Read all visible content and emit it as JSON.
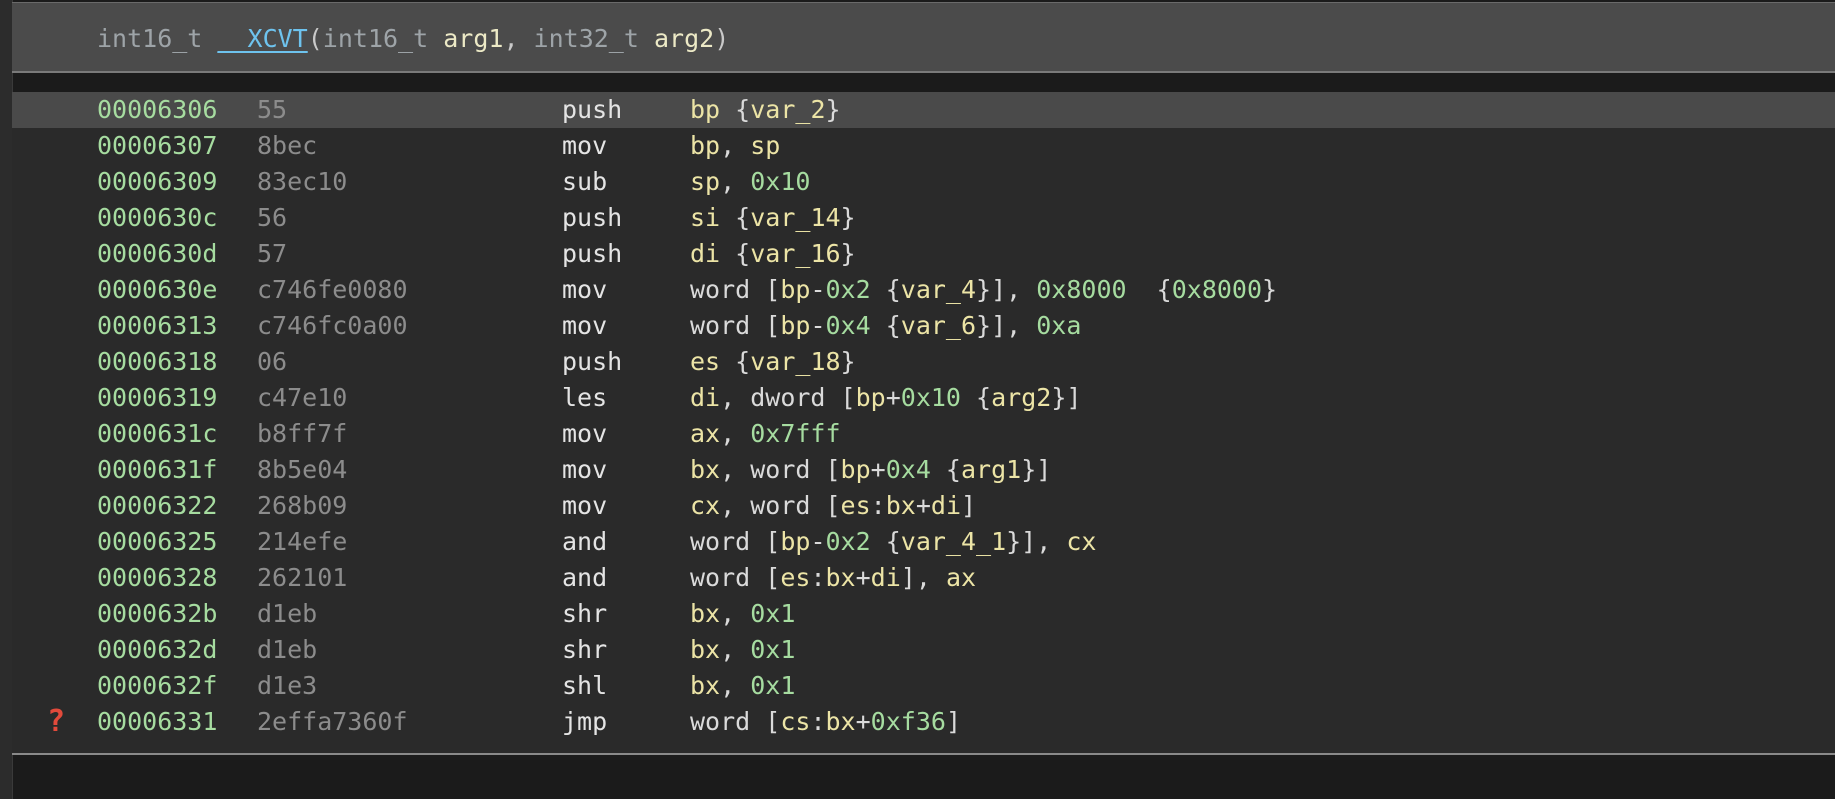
{
  "function_header": {
    "tokens": [
      {
        "text": "int16_t",
        "kind": "type"
      },
      {
        "text": " ",
        "kind": "punct"
      },
      {
        "text": "__XCVT",
        "kind": "fn"
      },
      {
        "text": "(",
        "kind": "punct"
      },
      {
        "text": "int16_t",
        "kind": "type"
      },
      {
        "text": " ",
        "kind": "punct"
      },
      {
        "text": "arg1",
        "kind": "arg"
      },
      {
        "text": ", ",
        "kind": "punct"
      },
      {
        "text": "int32_t",
        "kind": "type"
      },
      {
        "text": " ",
        "kind": "punct"
      },
      {
        "text": "arg2",
        "kind": "arg"
      },
      {
        "text": ")",
        "kind": "punct"
      }
    ]
  },
  "instructions": [
    {
      "address": "00006306",
      "bytes": "55",
      "mnemonic": "push",
      "selected": true,
      "operands": [
        {
          "t": "bp",
          "k": "reg"
        },
        {
          "t": " ",
          "k": "ws"
        },
        {
          "t": "{",
          "k": "punct"
        },
        {
          "t": "var_2",
          "k": "var"
        },
        {
          "t": "}",
          "k": "punct"
        }
      ]
    },
    {
      "address": "00006307",
      "bytes": "8bec",
      "mnemonic": "mov",
      "operands": [
        {
          "t": "bp",
          "k": "reg"
        },
        {
          "t": ", ",
          "k": "punct"
        },
        {
          "t": "sp",
          "k": "reg"
        }
      ]
    },
    {
      "address": "00006309",
      "bytes": "83ec10",
      "mnemonic": "sub",
      "operands": [
        {
          "t": "sp",
          "k": "reg"
        },
        {
          "t": ", ",
          "k": "punct"
        },
        {
          "t": "0x10",
          "k": "num"
        }
      ]
    },
    {
      "address": "0000630c",
      "bytes": "56",
      "mnemonic": "push",
      "operands": [
        {
          "t": "si",
          "k": "reg"
        },
        {
          "t": " ",
          "k": "ws"
        },
        {
          "t": "{",
          "k": "punct"
        },
        {
          "t": "var_14",
          "k": "var"
        },
        {
          "t": "}",
          "k": "punct"
        }
      ]
    },
    {
      "address": "0000630d",
      "bytes": "57",
      "mnemonic": "push",
      "operands": [
        {
          "t": "di",
          "k": "reg"
        },
        {
          "t": " ",
          "k": "ws"
        },
        {
          "t": "{",
          "k": "punct"
        },
        {
          "t": "var_16",
          "k": "var"
        },
        {
          "t": "}",
          "k": "punct"
        }
      ]
    },
    {
      "address": "0000630e",
      "bytes": "c746fe0080",
      "mnemonic": "mov",
      "operands": [
        {
          "t": "word",
          "k": "kw"
        },
        {
          "t": " [",
          "k": "punct"
        },
        {
          "t": "bp",
          "k": "reg"
        },
        {
          "t": "-",
          "k": "punct"
        },
        {
          "t": "0x2",
          "k": "num"
        },
        {
          "t": " {",
          "k": "punct"
        },
        {
          "t": "var_4",
          "k": "var"
        },
        {
          "t": "}], ",
          "k": "punct"
        },
        {
          "t": "0x8000",
          "k": "num"
        },
        {
          "t": "  {",
          "k": "punct"
        },
        {
          "t": "0x8000",
          "k": "num"
        },
        {
          "t": "}",
          "k": "punct"
        }
      ]
    },
    {
      "address": "00006313",
      "bytes": "c746fc0a00",
      "mnemonic": "mov",
      "operands": [
        {
          "t": "word",
          "k": "kw"
        },
        {
          "t": " [",
          "k": "punct"
        },
        {
          "t": "bp",
          "k": "reg"
        },
        {
          "t": "-",
          "k": "punct"
        },
        {
          "t": "0x4",
          "k": "num"
        },
        {
          "t": " {",
          "k": "punct"
        },
        {
          "t": "var_6",
          "k": "var"
        },
        {
          "t": "}], ",
          "k": "punct"
        },
        {
          "t": "0xa",
          "k": "num"
        }
      ]
    },
    {
      "address": "00006318",
      "bytes": "06",
      "mnemonic": "push",
      "operands": [
        {
          "t": "es",
          "k": "reg"
        },
        {
          "t": " ",
          "k": "ws"
        },
        {
          "t": "{",
          "k": "punct"
        },
        {
          "t": "var_18",
          "k": "var"
        },
        {
          "t": "}",
          "k": "punct"
        }
      ]
    },
    {
      "address": "00006319",
      "bytes": "c47e10",
      "mnemonic": "les",
      "operands": [
        {
          "t": "di",
          "k": "reg"
        },
        {
          "t": ", ",
          "k": "punct"
        },
        {
          "t": "dword",
          "k": "kw"
        },
        {
          "t": " [",
          "k": "punct"
        },
        {
          "t": "bp",
          "k": "reg"
        },
        {
          "t": "+",
          "k": "punct"
        },
        {
          "t": "0x10",
          "k": "num"
        },
        {
          "t": " {",
          "k": "punct"
        },
        {
          "t": "arg2",
          "k": "var"
        },
        {
          "t": "}]",
          "k": "punct"
        }
      ]
    },
    {
      "address": "0000631c",
      "bytes": "b8ff7f",
      "mnemonic": "mov",
      "operands": [
        {
          "t": "ax",
          "k": "reg"
        },
        {
          "t": ", ",
          "k": "punct"
        },
        {
          "t": "0x7fff",
          "k": "num"
        }
      ]
    },
    {
      "address": "0000631f",
      "bytes": "8b5e04",
      "mnemonic": "mov",
      "operands": [
        {
          "t": "bx",
          "k": "reg"
        },
        {
          "t": ", ",
          "k": "punct"
        },
        {
          "t": "word",
          "k": "kw"
        },
        {
          "t": " [",
          "k": "punct"
        },
        {
          "t": "bp",
          "k": "reg"
        },
        {
          "t": "+",
          "k": "punct"
        },
        {
          "t": "0x4",
          "k": "num"
        },
        {
          "t": " {",
          "k": "punct"
        },
        {
          "t": "arg1",
          "k": "var"
        },
        {
          "t": "}]",
          "k": "punct"
        }
      ]
    },
    {
      "address": "00006322",
      "bytes": "268b09",
      "mnemonic": "mov",
      "operands": [
        {
          "t": "cx",
          "k": "reg"
        },
        {
          "t": ", ",
          "k": "punct"
        },
        {
          "t": "word",
          "k": "kw"
        },
        {
          "t": " [",
          "k": "punct"
        },
        {
          "t": "es",
          "k": "reg"
        },
        {
          "t": ":",
          "k": "punct"
        },
        {
          "t": "bx",
          "k": "reg"
        },
        {
          "t": "+",
          "k": "punct"
        },
        {
          "t": "di",
          "k": "reg"
        },
        {
          "t": "]",
          "k": "punct"
        }
      ]
    },
    {
      "address": "00006325",
      "bytes": "214efe",
      "mnemonic": "and",
      "operands": [
        {
          "t": "word",
          "k": "kw"
        },
        {
          "t": " [",
          "k": "punct"
        },
        {
          "t": "bp",
          "k": "reg"
        },
        {
          "t": "-",
          "k": "punct"
        },
        {
          "t": "0x2",
          "k": "num"
        },
        {
          "t": " {",
          "k": "punct"
        },
        {
          "t": "var_4_1",
          "k": "var"
        },
        {
          "t": "}], ",
          "k": "punct"
        },
        {
          "t": "cx",
          "k": "reg"
        }
      ]
    },
    {
      "address": "00006328",
      "bytes": "262101",
      "mnemonic": "and",
      "operands": [
        {
          "t": "word",
          "k": "kw"
        },
        {
          "t": " [",
          "k": "punct"
        },
        {
          "t": "es",
          "k": "reg"
        },
        {
          "t": ":",
          "k": "punct"
        },
        {
          "t": "bx",
          "k": "reg"
        },
        {
          "t": "+",
          "k": "punct"
        },
        {
          "t": "di",
          "k": "reg"
        },
        {
          "t": "], ",
          "k": "punct"
        },
        {
          "t": "ax",
          "k": "reg"
        }
      ]
    },
    {
      "address": "0000632b",
      "bytes": "d1eb",
      "mnemonic": "shr",
      "operands": [
        {
          "t": "bx",
          "k": "reg"
        },
        {
          "t": ", ",
          "k": "punct"
        },
        {
          "t": "0x1",
          "k": "num"
        }
      ]
    },
    {
      "address": "0000632d",
      "bytes": "d1eb",
      "mnemonic": "shr",
      "operands": [
        {
          "t": "bx",
          "k": "reg"
        },
        {
          "t": ", ",
          "k": "punct"
        },
        {
          "t": "0x1",
          "k": "num"
        }
      ]
    },
    {
      "address": "0000632f",
      "bytes": "d1e3",
      "mnemonic": "shl",
      "operands": [
        {
          "t": "bx",
          "k": "reg"
        },
        {
          "t": ", ",
          "k": "punct"
        },
        {
          "t": "0x1",
          "k": "num"
        }
      ]
    },
    {
      "address": "00006331",
      "bytes": "2effa7360f",
      "mnemonic": "jmp",
      "marker": "?",
      "operands": [
        {
          "t": "word",
          "k": "kw"
        },
        {
          "t": " [",
          "k": "punct"
        },
        {
          "t": "cs",
          "k": "reg"
        },
        {
          "t": ":",
          "k": "punct"
        },
        {
          "t": "bx",
          "k": "reg"
        },
        {
          "t": "+",
          "k": "punct"
        },
        {
          "t": "0xf36",
          "k": "num"
        },
        {
          "t": "]",
          "k": "punct"
        }
      ]
    }
  ],
  "colors": {
    "address": "#a6dca0",
    "bytes": "#8c8c8c",
    "register": "#ece4a6",
    "number": "#a6dca0",
    "function_name": "#6ec3ee",
    "selected_row_bg": "#4a4a4a",
    "marker": "#e24a3b"
  }
}
